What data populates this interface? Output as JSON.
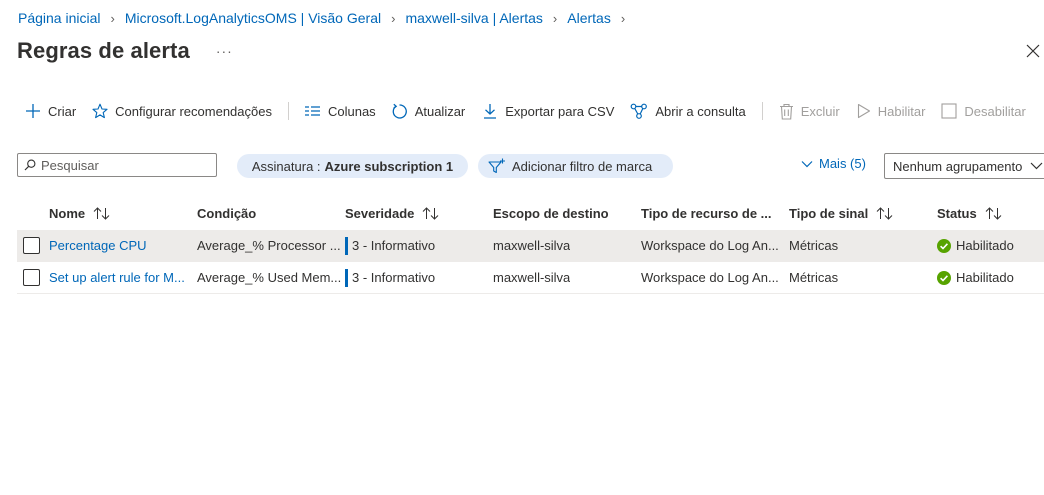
{
  "breadcrumb": [
    {
      "label": "Página inicial"
    },
    {
      "label": "Microsoft.LogAnalyticsOMS | Visão Geral"
    },
    {
      "label": "maxwell-silva | Alertas"
    },
    {
      "label": "Alertas"
    }
  ],
  "page": {
    "title": "Regras de alerta",
    "more": "···"
  },
  "toolbar": {
    "create": "Criar",
    "configure": "Configurar recomendações",
    "columns": "Colunas",
    "refresh": "Atualizar",
    "export": "Exportar para CSV",
    "open_query": "Abrir a consulta",
    "delete": "Excluir",
    "enable": "Habilitar",
    "disable": "Desabilitar"
  },
  "filters": {
    "search_placeholder": "Pesquisar",
    "subscription_label": "Assinatura :",
    "subscription_value": "Azure subscription 1",
    "add_tag_filter": "Adicionar filtro de marca",
    "more": "Mais (5)",
    "grouping": "Nenhum agrupamento"
  },
  "table": {
    "headers": {
      "name": "Nome",
      "condition": "Condição",
      "severity": "Severidade",
      "scope": "Escopo de destino",
      "resource_type": "Tipo de recurso de ...",
      "signal_type": "Tipo de sinal",
      "status": "Status"
    },
    "rows": [
      {
        "name": "Percentage CPU",
        "condition": "Average_% Processor ...",
        "severity": "3 - Informativo",
        "scope": "maxwell-silva",
        "resource_type": "Workspace do Log An...",
        "signal_type": "Métricas",
        "status": "Habilitado"
      },
      {
        "name": "Set up alert rule for M...",
        "condition": "Average_% Used Mem...",
        "severity": "3 - Informativo",
        "scope": "maxwell-silva",
        "resource_type": "Workspace do Log An...",
        "signal_type": "Métricas",
        "status": "Habilitado"
      }
    ]
  },
  "colors": {
    "link": "#0067b8",
    "status_enabled": "#57a300",
    "severity_bar": "#0067b8",
    "pill_bg": "#e3ecf9",
    "selected_row": "#edebe9"
  },
  "icons": {
    "create": "plus-icon",
    "configure": "star-icon",
    "columns": "columns-icon",
    "refresh": "refresh-icon",
    "export": "download-icon",
    "open_query": "query-icon",
    "delete": "trash-icon",
    "enable": "play-icon",
    "disable": "square-icon",
    "search": "search-icon",
    "filter": "filter-add-icon",
    "more": "chevron-down-icon",
    "sort": "sort-icon",
    "status": "check-circle-icon",
    "close": "close-icon"
  }
}
